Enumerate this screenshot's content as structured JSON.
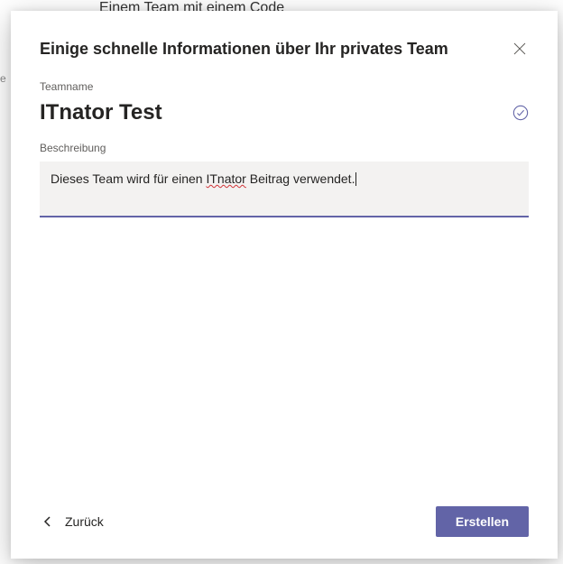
{
  "backdrop": {
    "hint": "Einem Team mit einem Code",
    "left_fragment": "e"
  },
  "modal": {
    "title": "Einige schnelle Informationen über Ihr privates Team",
    "fields": {
      "teamname": {
        "label": "Teamname",
        "value": "ITnator Test",
        "validated": true
      },
      "description": {
        "label": "Beschreibung",
        "value_pre": "Dieses Team wird für einen ",
        "value_spellcheck": "ITnator",
        "value_post": " Beitrag verwendet."
      }
    },
    "footer": {
      "back": "Zurück",
      "create": "Erstellen"
    }
  },
  "colors": {
    "accent": "#6264a7",
    "input_bg": "#f3f2f1"
  }
}
